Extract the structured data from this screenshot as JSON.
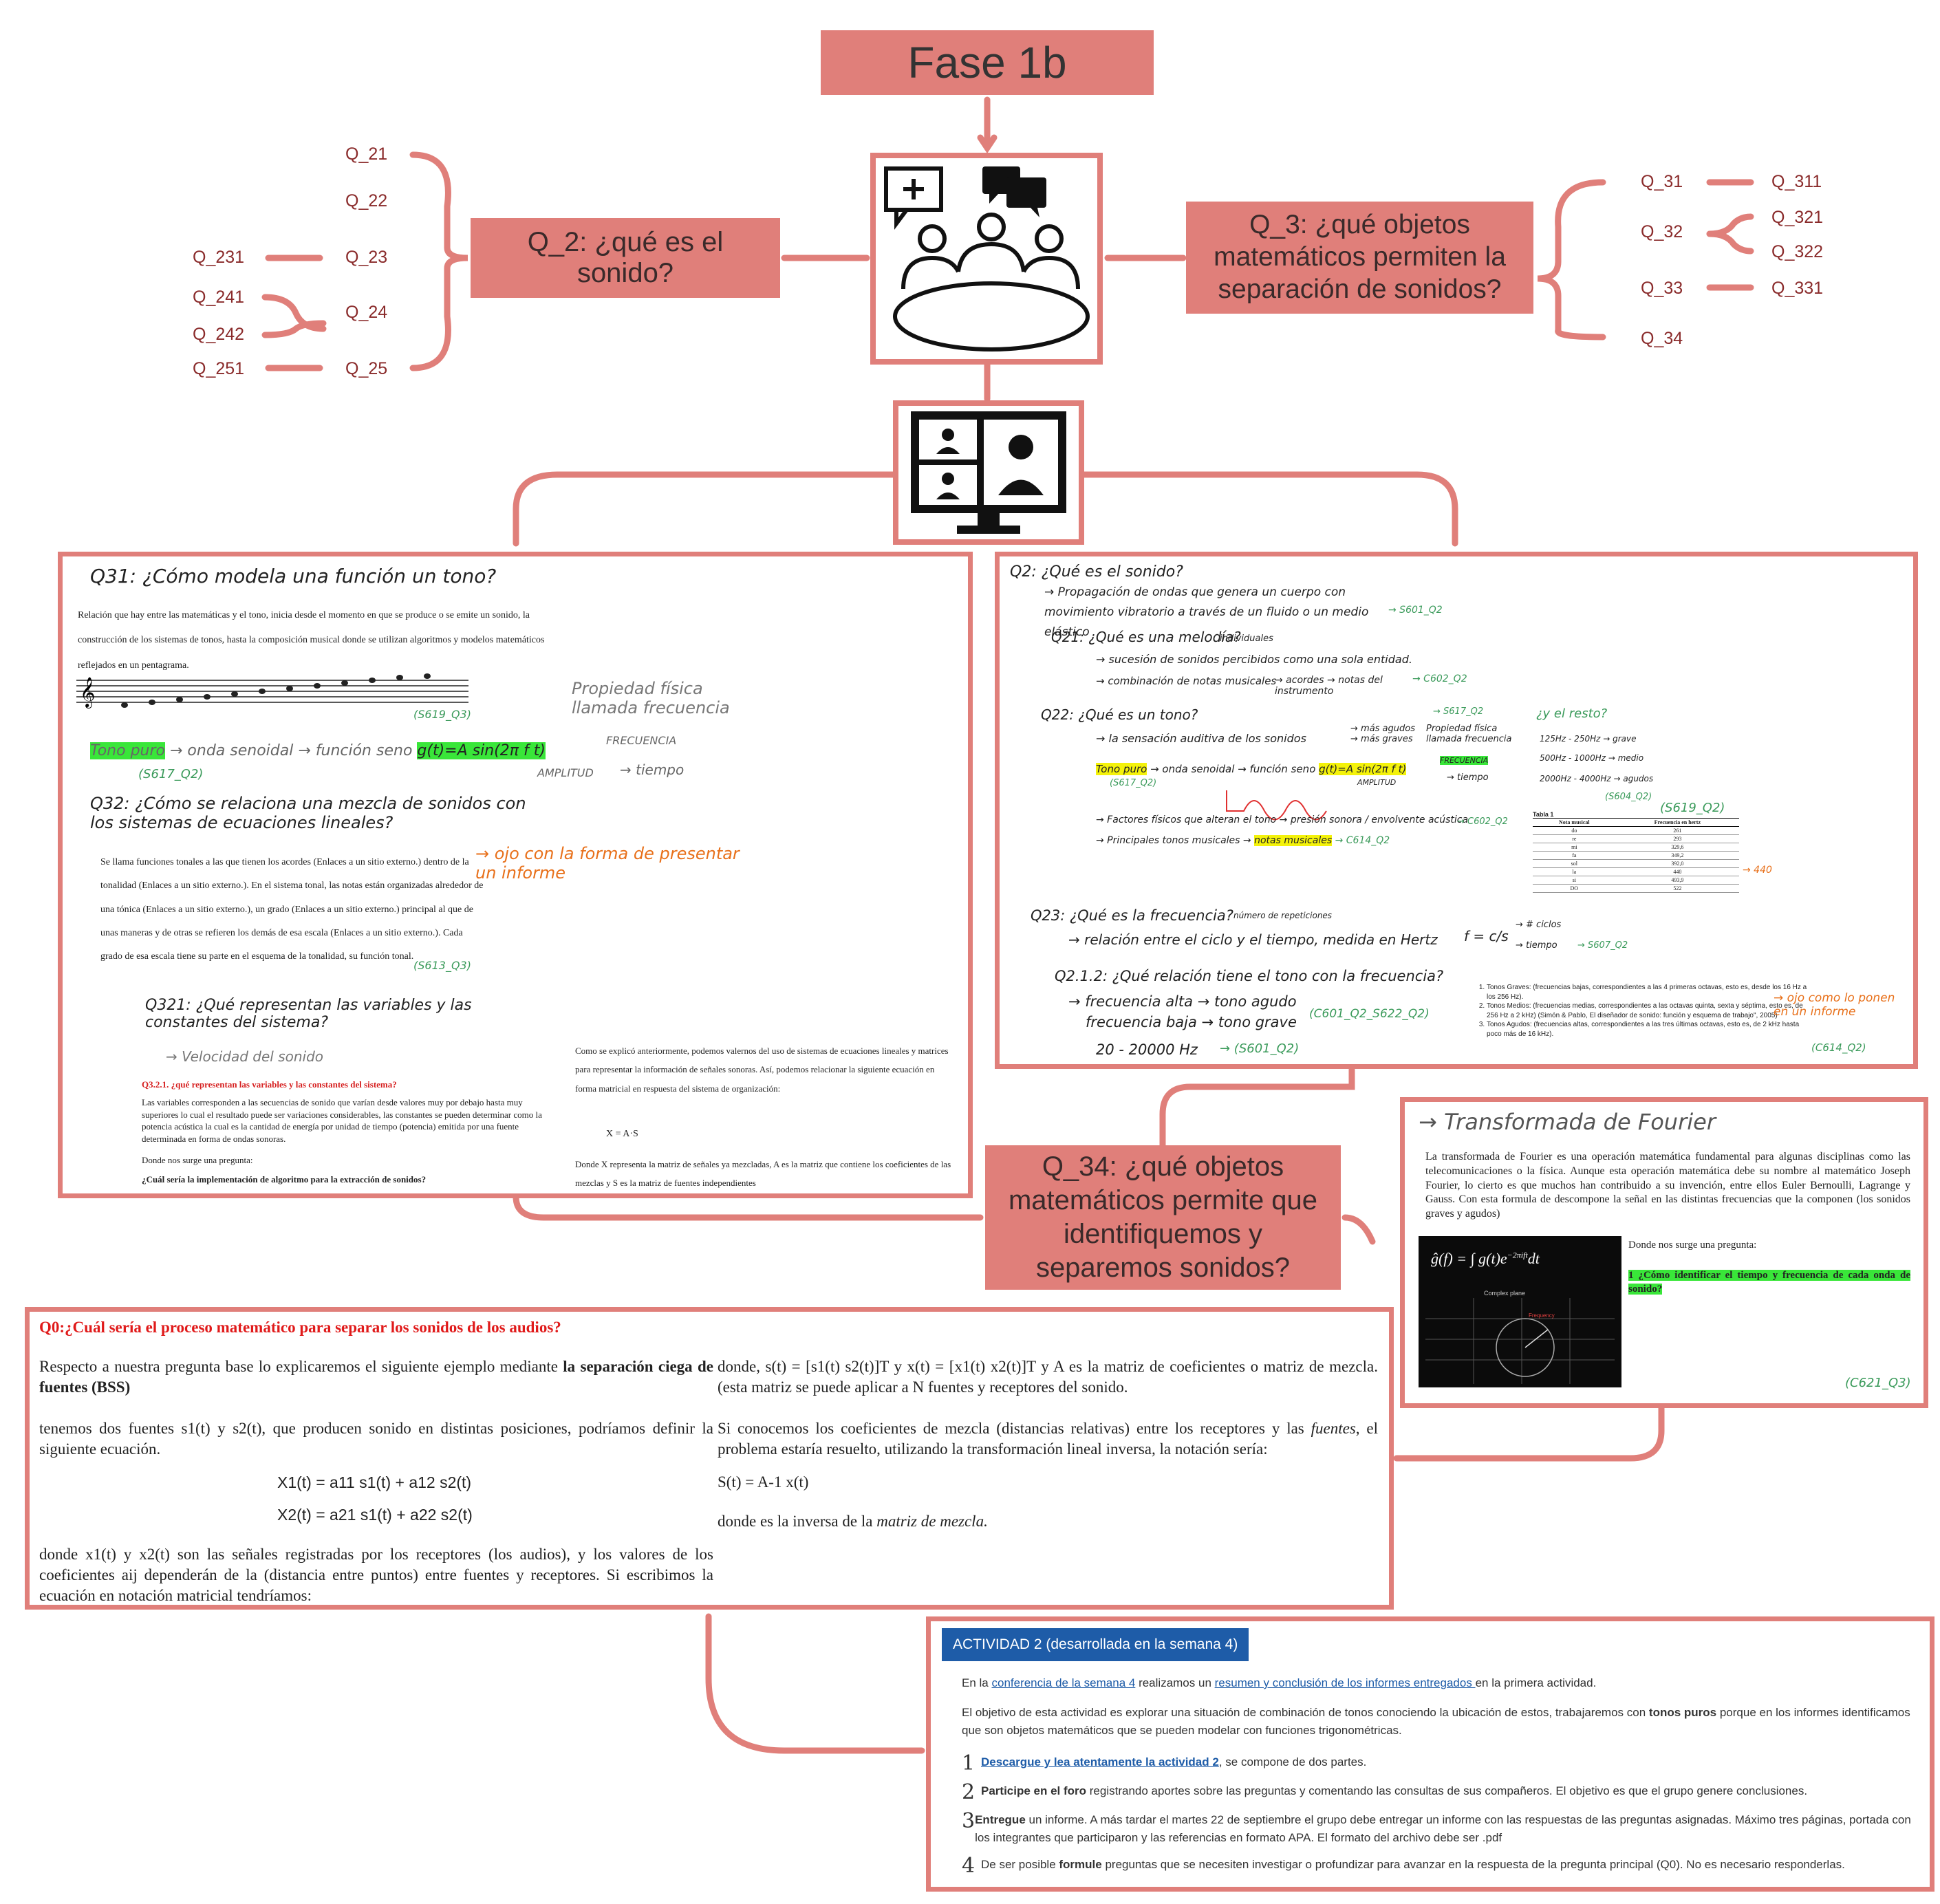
{
  "title": "Fase 1b",
  "q2": {
    "title": "Q_2: ¿qué es el sonido?",
    "subs": [
      "Q_21",
      "Q_22",
      "Q_23",
      "Q_24",
      "Q_25"
    ],
    "leaves": [
      "Q_231",
      "Q_241",
      "Q_242",
      "Q_251"
    ]
  },
  "q3": {
    "title": "Q_3: ¿qué objetos matemáticos permiten la separación de sonidos?",
    "subs": [
      "Q_31",
      "Q_32",
      "Q_33",
      "Q_34"
    ],
    "leaves": [
      "Q_311",
      "Q_321",
      "Q_322",
      "Q_331"
    ]
  },
  "q34": {
    "title": "Q_34: ¿qué objetos matemáticos permite que identifiquemos y separemos sonidos?"
  },
  "left_panel": {
    "q31": "Q31: ¿Cómo modela una función un tono?",
    "intro": "Relación que hay entre las matemáticas y el tono, inicia desde el momento en que se produce o se emite un sonido, la construcción de los sistemas de tonos, hasta la composición musical donde se utilizan algoritmos y modelos matemáticos reflejados en un pentagrama.",
    "s619": "(S619_Q3)",
    "prop": "Propiedad física llamada frecuencia",
    "tono_puro": "Tono puro",
    "onda": "→ onda senoidal → función seno",
    "formula": "g(t)=A sin(2π f t)",
    "frec": "FRECUENCIA",
    "ampl": "AMPLITUD",
    "tiempo": "→ tiempo",
    "s617": "(S617_Q2)",
    "q32": "Q32: ¿Cómo se relaciona una mezcla de sonidos con los sistemas de ecuaciones lineales?",
    "ojo": "→ ojo con la forma de presentar un informe",
    "tonal": "Se llama funciones tonales a las que tienen los acordes (Enlaces a un sitio externo.) dentro de la tonalidad (Enlaces a un sitio externo.). En el sistema tonal, las notas están organizadas alrededor de una tónica (Enlaces a un sitio externo.), un grado (Enlaces a un sitio externo.) principal al que de unas maneras y de otras se refieren los demás de esa escala (Enlaces a un sitio externo.). Cada grado de esa escala tiene su parte en el esquema de la tonalidad, su función tonal.",
    "s613": "(S613_Q3)",
    "q321": "Q321: ¿Qué representan las variables y las constantes del sistema?",
    "velocidad": "→ Velocidad del sonido",
    "q321b": "Q3.2.1. ¿qué representan las variables y las constantes del sistema?",
    "var_text": "Las variables corresponden a las secuencias de sonido que varían desde valores muy por debajo hasta muy superiores lo cual el resultado puede ser variaciones considerables, las constantes se pueden determinar como la potencia acústica la cual es la cantidad de energía por unidad de tiempo (potencia) emitida por una fuente determinada en forma de ondas sonoras.",
    "donde_pregunta": "Donde nos surge una pregunta:",
    "cual": "¿Cuál sería la implementación de algoritmo para la extracción de sonidos?",
    "right_col1": "Como se explicó anteriormente, podemos valernos del uso de sistemas de ecuaciones lineales y matrices para representar la información de señales sonoras. Así, podemos relacionar la siguiente ecuación en forma matricial en respuesta del sistema de organización:",
    "xas": "X = A·S",
    "right_col2": "Donde X representa la matriz de señales ya mezcladas, A es la matriz que contiene los coeficientes de las mezclas y S es la matriz de fuentes independientes"
  },
  "right_panel": {
    "q2": "Q2: ¿Qué es el sonido?",
    "prop": "→ Propagación de ondas que genera un cuerpo con movimiento vibratorio a través de un fluido o un medio elástico",
    "s601": "→ S601_Q2",
    "q21": "Q21: ¿Qué es una melodía?",
    "individuales": "individuales",
    "suc": "→ sucesión de sonidos percibidos como una sola entidad.",
    "comb": "→ combinación de notas musicales",
    "acordes": "→ acordes → notas del instrumento",
    "c602": "→ C602_Q2",
    "q22": "Q22: ¿Qué es un tono?",
    "sens": "→ la sensación auditiva de los sonidos",
    "agudos": "→ más agudos → más graves",
    "prop_fis": "Propiedad física llamada frecuencia",
    "s617": "→ S617_Q2",
    "resto": "¿y el resto?",
    "g1": "125Hz - 250Hz → grave",
    "g2": "500Hz - 1000Hz → medio",
    "g3": "2000Hz - 4000Hz → agudos",
    "s604": "(S604_Q2)",
    "tono_puro": "Tono puro",
    "onda": "→ onda senoidal → función seno",
    "formula": "g(t)=A sin(2π f t)",
    "frecuencia": "FRECUENCIA",
    "tiempo": "→ tiempo",
    "amplitud": "AMPLITUD",
    "s617b": "(S617_Q2)",
    "factores": "→ Factores físicos que alteran el tono → presión sonora / envolvente acústica",
    "c602b": "→ C602_Q2",
    "principales": "→ Principales tonos musicales →",
    "notas": "notas musicales",
    "c614": "→ C614_Q2",
    "tabla_title": "Tabla 1",
    "tabla_head": [
      "Nota musical",
      "Frecuencia en hertz"
    ],
    "tabla_rows": [
      [
        "do",
        "261"
      ],
      [
        "re",
        "293"
      ],
      [
        "mi",
        "329,6"
      ],
      [
        "fa",
        "349,2"
      ],
      [
        "sol",
        "392,0"
      ],
      [
        "la",
        "440"
      ],
      [
        "si",
        "493,9"
      ],
      [
        "DO",
        "522"
      ]
    ],
    "s619": "(S619_Q2)",
    "n440": "→ 440",
    "q23": "Q23: ¿Qué es la frecuencia?",
    "num_rep": "número de repeticiones",
    "rel": "→ relación entre el ciclo y el tiempo, medida en Hertz",
    "f": "f = c/s",
    "ciclos": "→ # ciclos",
    "tiempo2": "→ tiempo",
    "s607": "→ S607_Q2",
    "q212": "Q2.1.2: ¿Qué relación tiene el tono con la frecuencia?",
    "alta": "→ frecuencia alta → tono agudo",
    "baja": "frecuencia baja → tono grave",
    "c601": "(C601_Q2_S622_Q2)",
    "rango": "20 - 20000 Hz",
    "s601b": "→ (S601_Q2)",
    "tonos": [
      "Tonos Graves: (frecuencias bajas, correspondientes a las 4 primeras octavas, esto es, desde los 16 Hz a los 256 Hz).",
      "Tonos Medios: (frecuencias medias, correspondientes a las octavas quinta, sexta y séptima, esto es, de 256 Hz a 2 kHz) (Simón & Pablo, El diseñador de sonido: función y esquema de trabajo\", 2005)",
      "Tonos Agudos: (frecuencias altas, correspondientes a las tres últimas octavas, esto es, de 2 kHz hasta poco más de 16 kHz)."
    ],
    "ojo2": "→ ojo como lo ponen en un informe",
    "c614b": "(C614_Q2)"
  },
  "fourier_panel": {
    "title": "→ Transformada de Fourier",
    "text": "La transformada de Fourier es una operación matemática fundamental para algunas disciplinas como las telecomunicaciones o la física. Aunque esta operación matemática debe su nombre al matemático Joseph Fourier, lo cierto es que muchos han contribuido a su invención, entre ellos Euler Bernoulli, Lagrange y Gauss. Con esta formula de descompone la señal en las distintas frecuencias que la componen (los sonidos graves y agudos)",
    "donde": "Donde nos surge una pregunta:",
    "pregunta": "1 ¿Cómo identificar el tiempo y frecuencia de cada onda de sonido?",
    "ref": "(C621_Q3)",
    "plot_title": "Complex plane",
    "plot_label": "Frequency"
  },
  "bss_panel": {
    "title": "Q0:¿Cuál sería el proceso matemático para separar los sonidos de los audios?",
    "p1a": "Respecto a nuestra pregunta base lo explicaremos el siguiente ejemplo mediante ",
    "p1b": "la separación ciega de fuentes (BSS)",
    "p2": "tenemos dos fuentes s1(t) y s2(t), que producen sonido en distintas posiciones, podríamos definir la siguiente ecuación.",
    "eq1": "X1(t) = a11 s1(t) + a12 s2(t)",
    "eq2": "X2(t) = a21 s1(t) + a22 s2(t)",
    "p3": "donde x1(t) y x2(t) son las señales registradas por los receptores (los audios), y los valores de los coeficientes aij dependerán de la (distancia entre puntos) entre fuentes y receptores. Si escribimos la ecuación en notación matricial tendríamos:",
    "r1": "donde, s(t) = [s1(t) s2(t)]T y x(t) = [x1(t) x2(t)]T y A es la matriz de coeficientes o matriz de mezcla. (esta matriz se puede aplicar a N fuentes y receptores del sonido.",
    "r2a": "Si conocemos los coeficientes de mezcla (distancias relativas) entre los receptores y las ",
    "r2b": "fuentes",
    "r2c": ", el problema estaría resuelto, utilizando la transformación lineal inversa, la notación sería:",
    "r3": "S(t) = A-1 x(t)",
    "r4a": "donde   es la inversa de la ",
    "r4b": "matriz de mezcla."
  },
  "activity_panel": {
    "header": "ACTIVIDAD 2 (desarrollada en la semana 4)",
    "intro_a": "En la ",
    "intro_link1": "conferencia de la semana 4",
    "intro_b": " realizamos un ",
    "intro_link2": "resumen y conclusión de los informes entregados ",
    "intro_c": "en la primera actividad.",
    "objetivo_a": "El objetivo de esta actividad es explorar una situación de combinación de tonos conociendo la ubicación de estos, trabajaremos con ",
    "objetivo_b": "tonos puros",
    "objetivo_c": " porque en los informes identificamos que son objetos matemáticos que se pueden modelar con funciones trigonométricas.",
    "steps": [
      {
        "num": "1",
        "bold": "Descargue y lea atentamente la actividad 2",
        "text": ", se compone de dos partes."
      },
      {
        "num": "2",
        "bold": "Participe en el foro",
        "text": " registrando aportes sobre las preguntas y comentando las consultas de sus compañeros. El objetivo es que el grupo genere conclusiones."
      },
      {
        "num": "3",
        "bold": "Entregue",
        "text": " un informe. A más tardar el martes 22 de septiembre el grupo debe entregar un informe con las respuestas de las preguntas asignadas. Máximo tres páginas, portada con los integrantes que participaron y las referencias en formato APA. El formato del archivo debe ser .pdf"
      },
      {
        "num": "4",
        "bold": "formule",
        "pre": "De ser posible ",
        "text": " preguntas que se necesiten investigar o profundizar para avanzar en la respuesta de la pregunta principal (Q0). No es necesario responderlas."
      }
    ]
  },
  "colors": {
    "accent": "#e07f7a",
    "label": "#8a2b2b",
    "highlight_green": "#39e639",
    "activity_blue": "#1e5ca8"
  }
}
